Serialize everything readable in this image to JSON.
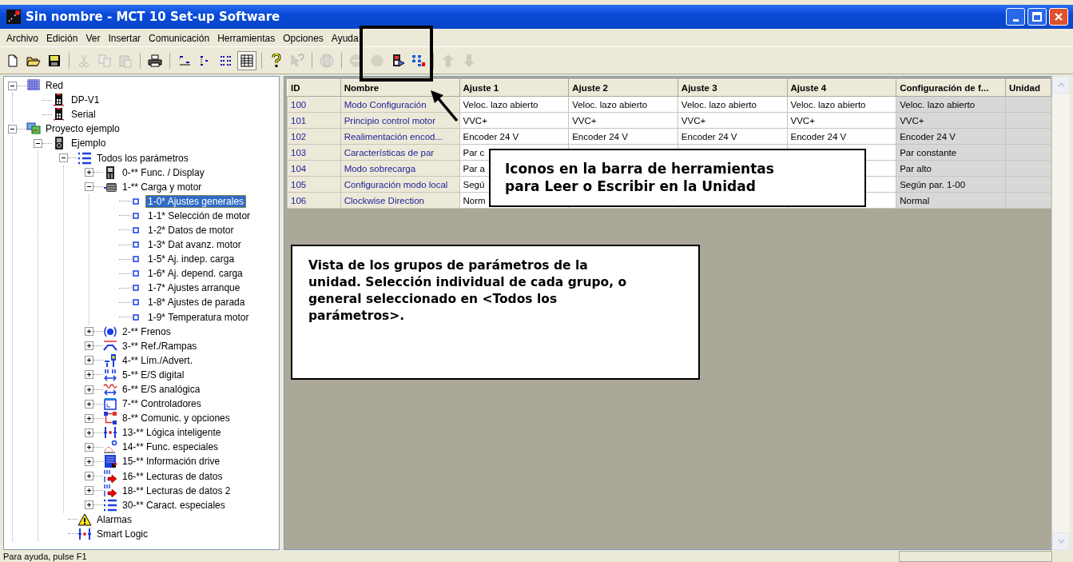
{
  "window": {
    "title": "Sin nombre - MCT 10 Set-up Software"
  },
  "menu": [
    "Archivo",
    "Edición",
    "Ver",
    "Insertar",
    "Comunicación",
    "Herramientas",
    "Opciones",
    "Ayuda"
  ],
  "toolbar": [
    {
      "kind": "new",
      "disabled": false
    },
    {
      "kind": "open",
      "disabled": false
    },
    {
      "kind": "save",
      "disabled": false
    },
    {
      "kind": "separator"
    },
    {
      "kind": "cut",
      "disabled": true
    },
    {
      "kind": "copy",
      "disabled": true
    },
    {
      "kind": "paste",
      "disabled": true
    },
    {
      "kind": "separator"
    },
    {
      "kind": "print",
      "disabled": false
    },
    {
      "kind": "separator"
    },
    {
      "kind": "view1",
      "disabled": false,
      "pressed": false
    },
    {
      "kind": "view2",
      "disabled": false,
      "pressed": false
    },
    {
      "kind": "view3",
      "disabled": false,
      "pressed": false
    },
    {
      "kind": "view4",
      "disabled": false,
      "pressed": true
    },
    {
      "kind": "separator"
    },
    {
      "kind": "help",
      "disabled": false
    },
    {
      "kind": "whatsthis",
      "disabled": true
    },
    {
      "kind": "separator"
    },
    {
      "kind": "device",
      "disabled": true
    },
    {
      "kind": "separator"
    },
    {
      "kind": "stop",
      "disabled": true
    },
    {
      "kind": "record",
      "disabled": true
    },
    {
      "kind": "read",
      "disabled": false
    },
    {
      "kind": "write",
      "disabled": false
    },
    {
      "kind": "separator"
    },
    {
      "kind": "up",
      "disabled": true
    },
    {
      "kind": "down",
      "disabled": true
    }
  ],
  "tree": [
    {
      "label": "Red",
      "kind": "network",
      "expanded": true,
      "selected": false,
      "children": [
        {
          "label": "DP-V1",
          "kind": "drive",
          "selected": false
        },
        {
          "label": "Serial",
          "kind": "drive",
          "selected": false
        }
      ]
    },
    {
      "label": "Proyecto ejemplo",
      "kind": "project",
      "expanded": true,
      "selected": false,
      "children": [
        {
          "label": "Ejemplo",
          "kind": "device",
          "expanded": true,
          "selected": false,
          "children": [
            {
              "label": "Todos los parámetros",
              "kind": "list",
              "expanded": true,
              "selected": false,
              "children": [
                {
                  "label": "0-** Func. / Display",
                  "kind": "display",
                  "expanded": false,
                  "selected": false
                },
                {
                  "label": "1-** Carga y motor",
                  "kind": "motor",
                  "expanded": true,
                  "selected": false,
                  "children": [
                    {
                      "label": "1-0* Ajustes generales",
                      "kind": "leaf",
                      "selected": true
                    },
                    {
                      "label": "1-1* Selección de motor",
                      "kind": "leaf",
                      "selected": false
                    },
                    {
                      "label": "1-2* Datos de motor",
                      "kind": "leaf",
                      "selected": false
                    },
                    {
                      "label": "1-3* Dat avanz. motor",
                      "kind": "leaf",
                      "selected": false
                    },
                    {
                      "label": "1-5* Aj. indep. carga",
                      "kind": "leaf",
                      "selected": false
                    },
                    {
                      "label": "1-6* Aj. depend. carga",
                      "kind": "leaf",
                      "selected": false
                    },
                    {
                      "label": "1-7* Ajustes arranque",
                      "kind": "leaf",
                      "selected": false
                    },
                    {
                      "label": "1-8* Ajustes de parada",
                      "kind": "leaf",
                      "selected": false
                    },
                    {
                      "label": "1-9* Temperatura motor",
                      "kind": "leaf",
                      "selected": false
                    }
                  ]
                },
                {
                  "label": "2-** Frenos",
                  "kind": "brake",
                  "expanded": false,
                  "selected": false
                },
                {
                  "label": "3-** Ref./Rampas",
                  "kind": "ramp",
                  "expanded": false,
                  "selected": false
                },
                {
                  "label": "4-** Lím./Advert.",
                  "kind": "limit",
                  "expanded": false,
                  "selected": false
                },
                {
                  "label": "5-** E/S digital",
                  "kind": "digital",
                  "expanded": false,
                  "selected": false
                },
                {
                  "label": "6-** E/S analógica",
                  "kind": "analog",
                  "expanded": false,
                  "selected": false
                },
                {
                  "label": "7-** Controladores",
                  "kind": "controller",
                  "expanded": false,
                  "selected": false
                },
                {
                  "label": "8-** Comunic. y opciones",
                  "kind": "comm",
                  "expanded": false,
                  "selected": false
                },
                {
                  "label": "13-** Lógica inteligente",
                  "kind": "logic",
                  "expanded": false,
                  "selected": false
                },
                {
                  "label": "14-** Func. especiales",
                  "kind": "special",
                  "expanded": false,
                  "selected": false
                },
                {
                  "label": "15-** Información drive",
                  "kind": "info",
                  "expanded": false,
                  "selected": false
                },
                {
                  "label": "16-** Lecturas de datos",
                  "kind": "readout",
                  "expanded": false,
                  "selected": false
                },
                {
                  "label": "18-** Lecturas de datos 2",
                  "kind": "readout",
                  "expanded": false,
                  "selected": false
                },
                {
                  "label": "30-** Caract. especiales",
                  "kind": "list",
                  "expanded": false,
                  "selected": false
                }
              ]
            },
            {
              "label": "Alarmas",
              "kind": "alarm",
              "selected": false
            },
            {
              "label": "Smart Logic",
              "kind": "logic",
              "selected": false
            }
          ]
        }
      ]
    }
  ],
  "table": {
    "columns": [
      {
        "label": "ID",
        "kind": "key"
      },
      {
        "label": "Nombre",
        "kind": "key"
      },
      {
        "label": "Ajuste 1",
        "kind": "setting"
      },
      {
        "label": "Ajuste 2",
        "kind": "setting"
      },
      {
        "label": "Ajuste 3",
        "kind": "setting"
      },
      {
        "label": "Ajuste 4",
        "kind": "setting"
      },
      {
        "label": "Configuración de f...",
        "kind": "readonly"
      },
      {
        "label": "Unidad",
        "kind": "readonly"
      }
    ],
    "rows": [
      [
        "100",
        "Modo Configuración",
        "Veloc. lazo abierto",
        "Veloc. lazo abierto",
        "Veloc. lazo abierto",
        "Veloc. lazo abierto",
        "Veloc. lazo abierto",
        null
      ],
      [
        "101",
        "Principio control motor",
        "VVC+",
        "VVC+",
        "VVC+",
        "VVC+",
        "VVC+",
        null
      ],
      [
        "102",
        "Realimentación encod...",
        "Encoder 24 V",
        "Encoder 24 V",
        "Encoder 24 V",
        "Encoder 24 V",
        "Encoder 24 V",
        null
      ],
      [
        "103",
        "Características de par",
        "Par c",
        null,
        null,
        null,
        "Par constante",
        null
      ],
      [
        "104",
        "Modo sobrecarga",
        "Par a",
        null,
        null,
        null,
        "Par alto",
        null
      ],
      [
        "105",
        "Configuración modo local",
        "Segú",
        null,
        null,
        null,
        "Según par. 1-00",
        null
      ],
      [
        "106",
        "Clockwise Direction",
        "Norm",
        null,
        null,
        null,
        "Normal",
        null
      ]
    ]
  },
  "status_bar": {
    "text": "Para ayuda, pulse F1"
  },
  "callouts": [
    {
      "kind": "toolbar",
      "text": "Iconos en la barra de herramientas para Leer o Escribir en la Unidad"
    },
    {
      "kind": "view",
      "text": "Vista de los grupos de parámetros de la unidad. Selección individual de cada grupo, o general seleccionado en <Todos los parámetros>."
    }
  ]
}
